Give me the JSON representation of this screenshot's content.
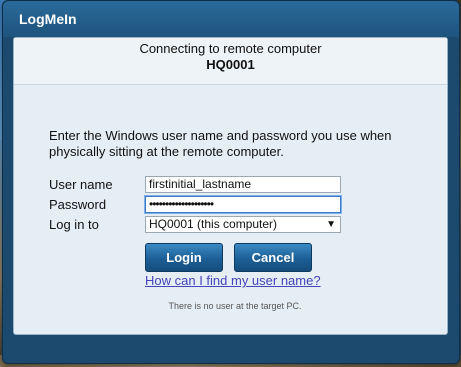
{
  "window": {
    "title": "LogMeIn"
  },
  "header": {
    "line1": "Connecting to remote computer",
    "computer_name": "HQ0001"
  },
  "instructions": "Enter the Windows user name and password you use when physically sitting at the remote computer.",
  "form": {
    "username_label": "User name",
    "username_value": "firstinitial_lastname",
    "password_label": "Password",
    "password_value": "••••••••••••••••••••",
    "login_to_label": "Log in to",
    "login_to_value": "HQ0001 (this computer)"
  },
  "buttons": {
    "login": "Login",
    "cancel": "Cancel"
  },
  "help_link": "How can I find my user name?",
  "status_text": "There is no user at the target PC.",
  "colors": {
    "titlebar": "#1e547e",
    "button": "#1c5f96",
    "link": "#4444bb"
  }
}
